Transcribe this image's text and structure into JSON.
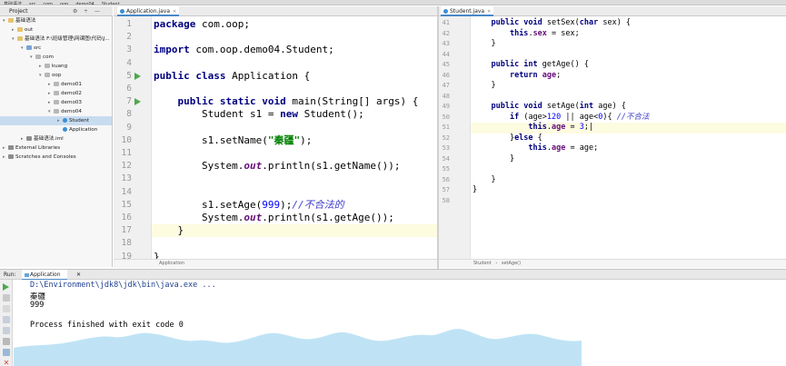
{
  "navbar": {
    "crumbs": [
      "基础语法",
      "src",
      "com",
      "oop",
      "demo04",
      "Student"
    ]
  },
  "project_panel": {
    "title": "Project",
    "tree": [
      {
        "label": "基础语法",
        "kind": "folder",
        "depth": 0,
        "expanded": true
      },
      {
        "label": "out",
        "kind": "folder",
        "depth": 1,
        "expanded": false
      },
      {
        "label": "基础语法 F:\\班级管理\\网课图\\代码\\J...",
        "kind": "folder",
        "depth": 1,
        "expanded": true
      },
      {
        "label": "src",
        "kind": "src",
        "depth": 2,
        "expanded": true
      },
      {
        "label": "com",
        "kind": "pkg",
        "depth": 3,
        "expanded": true
      },
      {
        "label": "kuang",
        "kind": "pkg",
        "depth": 4,
        "expanded": false
      },
      {
        "label": "oop",
        "kind": "pkg",
        "depth": 4,
        "expanded": true
      },
      {
        "label": "demo01",
        "kind": "pkg",
        "depth": 5,
        "expanded": false
      },
      {
        "label": "demo02",
        "kind": "pkg",
        "depth": 5,
        "expanded": false
      },
      {
        "label": "demo03",
        "kind": "pkg",
        "depth": 5,
        "expanded": false
      },
      {
        "label": "demo04",
        "kind": "pkg",
        "depth": 5,
        "expanded": true
      },
      {
        "label": "Student",
        "kind": "cls",
        "depth": 6,
        "expanded": false,
        "selected": true
      },
      {
        "label": "Application",
        "kind": "cls",
        "depth": 6,
        "expanded": false
      },
      {
        "label": "基础语法.iml",
        "kind": "lib",
        "depth": 2,
        "expanded": false
      },
      {
        "label": "External Libraries",
        "kind": "lib",
        "depth": 0,
        "expanded": false
      },
      {
        "label": "Scratches and Consoles",
        "kind": "lib",
        "depth": 0,
        "expanded": false
      }
    ]
  },
  "left_editor": {
    "tab": "Application.java",
    "status": "Application",
    "lines": [
      {
        "n": "1",
        "html": "<span class=\"kw\">package</span> com.oop;"
      },
      {
        "n": "2",
        "html": ""
      },
      {
        "n": "3",
        "html": "<span class=\"kw\">import</span> com.oop.demo04.Student;"
      },
      {
        "n": "4",
        "html": ""
      },
      {
        "n": "5",
        "html": "<span class=\"kw\">public class</span> Application {"
      },
      {
        "n": "6",
        "html": ""
      },
      {
        "n": "7",
        "html": "    <span class=\"kw\">public static void</span> main(String[] args) {"
      },
      {
        "n": "8",
        "html": "        Student s1 = <span class=\"kw\">new</span> Student();"
      },
      {
        "n": "9",
        "html": ""
      },
      {
        "n": "10",
        "html": "        s1.setName(<span class=\"str\">\"秦疆\"</span>);"
      },
      {
        "n": "11",
        "html": ""
      },
      {
        "n": "12",
        "html": "        System.<span class=\"stat\">out</span>.println(s1.getName());"
      },
      {
        "n": "13",
        "html": ""
      },
      {
        "n": "14",
        "html": ""
      },
      {
        "n": "15",
        "html": "        s1.setAge(<span class=\"num\">999</span>);<span class=\"cmt-cn\">//不合法的</span>"
      },
      {
        "n": "16",
        "html": "        System.<span class=\"stat\">out</span>.println(s1.getAge());"
      },
      {
        "n": "17",
        "html": "    }"
      },
      {
        "n": "18",
        "html": ""
      },
      {
        "n": "19",
        "html": "}"
      }
    ]
  },
  "right_editor": {
    "tab": "Student.java",
    "status": [
      "Student",
      "setAge()"
    ],
    "lines": [
      {
        "n": "41",
        "html": "    <span class=\"kw\">public void</span> setSex(<span class=\"kw\">char</span> sex) {"
      },
      {
        "n": "42",
        "html": "        <span class=\"kw\">this</span>.<span class=\"fld\">sex</span> = sex;"
      },
      {
        "n": "43",
        "html": "    }"
      },
      {
        "n": "44",
        "html": ""
      },
      {
        "n": "45",
        "html": "    <span class=\"kw\">public int</span> getAge() {"
      },
      {
        "n": "46",
        "html": "        <span class=\"kw\">return</span> <span class=\"fld\">age</span>;"
      },
      {
        "n": "47",
        "html": "    }"
      },
      {
        "n": "48",
        "html": ""
      },
      {
        "n": "49",
        "html": "    <span class=\"kw\">public void</span> setAge(<span class=\"kw\">int</span> age) {"
      },
      {
        "n": "50",
        "html": "        <span class=\"kw\">if</span> (age><span class=\"num\">120</span> || age<<span class=\"num\">0</span>){ <span class=\"cmt-cn\">//不合法</span>"
      },
      {
        "n": "51",
        "html": "            <span class=\"kw\">this</span>.<span class=\"fld\">age</span> = <span class=\"num\">3</span>;|"
      },
      {
        "n": "52",
        "html": "        }<span class=\"kw\">else</span> {"
      },
      {
        "n": "53",
        "html": "            <span class=\"kw\">this</span>.<span class=\"fld\">age</span> = age;"
      },
      {
        "n": "54",
        "html": "        }"
      },
      {
        "n": "55",
        "html": ""
      },
      {
        "n": "56",
        "html": "    }"
      },
      {
        "n": "57",
        "html": "}"
      },
      {
        "n": "58",
        "html": ""
      }
    ]
  },
  "run_panel": {
    "run_label": "Run:",
    "tab": "Application",
    "console": [
      "D:\\Environment\\jdk8\\jdk\\bin\\java.exe ...",
      "秦疆",
      "999",
      "",
      "Process finished with exit code 0"
    ]
  }
}
